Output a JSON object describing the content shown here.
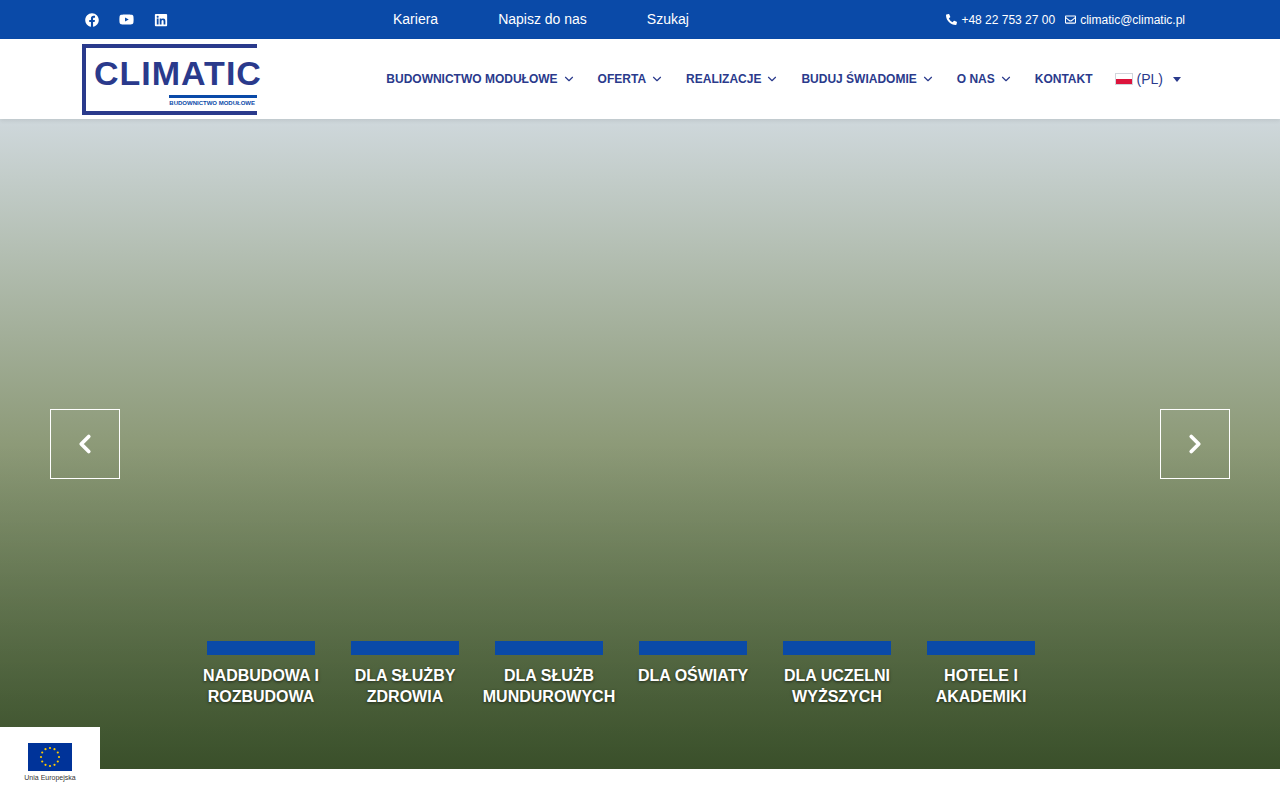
{
  "topbar": {
    "links": [
      "Kariera",
      "Napisz do nas",
      "Szukaj"
    ],
    "phone": "+48 22 753 27 00",
    "email": "climatic@climatic.pl"
  },
  "logo": {
    "name": "CLIMATIC",
    "tagline": "BUDOWNICTWO MODUŁOWE"
  },
  "nav": {
    "items": [
      {
        "label": "BUDOWNICTWO MODUŁOWE",
        "dropdown": true
      },
      {
        "label": "OFERTA",
        "dropdown": true
      },
      {
        "label": "REALIZACJE",
        "dropdown": true
      },
      {
        "label": "BUDUJ ŚWIADOMIE",
        "dropdown": true
      },
      {
        "label": "O NAS",
        "dropdown": true
      },
      {
        "label": "KONTAKT",
        "dropdown": false
      }
    ],
    "language": "(PL)"
  },
  "hero": {
    "categories": [
      "NADBUDOWA I ROZBUDOWA",
      "DLA SŁUŻBY ZDROWIA",
      "DLA SŁUŻB MUNDUROWYCH",
      "DLA OŚWIATY",
      "DLA UCZELNI WYŻSZYCH",
      "HOTELE I AKADEMIKI"
    ]
  },
  "eu_badge": {
    "label": "Unia Europejska"
  }
}
